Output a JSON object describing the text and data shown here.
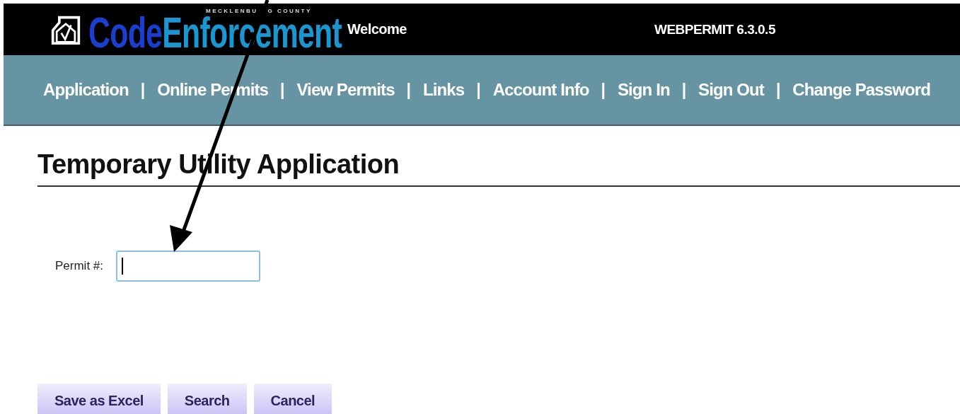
{
  "header": {
    "logo": {
      "county_before_arrow": "MECKLENBU",
      "county_after_arrow": "G COUNTY",
      "name_first": "Code",
      "name_second": "Enforcement"
    },
    "welcome": "Welcome",
    "version": "WEBPERMIT 6.3.0.5"
  },
  "nav": {
    "items": [
      {
        "label": "Application",
        "separator": "|"
      },
      {
        "label": "Online Permits",
        "separator": "|"
      },
      {
        "label": "View Permits",
        "separator": "|"
      },
      {
        "label": "Links",
        "separator": "|"
      },
      {
        "label": "Account Info",
        "separator": "|"
      },
      {
        "label": "Sign In",
        "separator": "|"
      },
      {
        "label": "Sign Out",
        "separator": "|"
      },
      {
        "label": "Change Password"
      }
    ]
  },
  "page": {
    "title": "Temporary Utility Application"
  },
  "form": {
    "fields": [
      {
        "label": "Permit #:",
        "focused": true
      }
    ]
  },
  "buttons": [
    {
      "label": "Save as Excel"
    },
    {
      "label": "Search"
    },
    {
      "label": "Cancel"
    }
  ],
  "annotation": {
    "arrow": true
  }
}
